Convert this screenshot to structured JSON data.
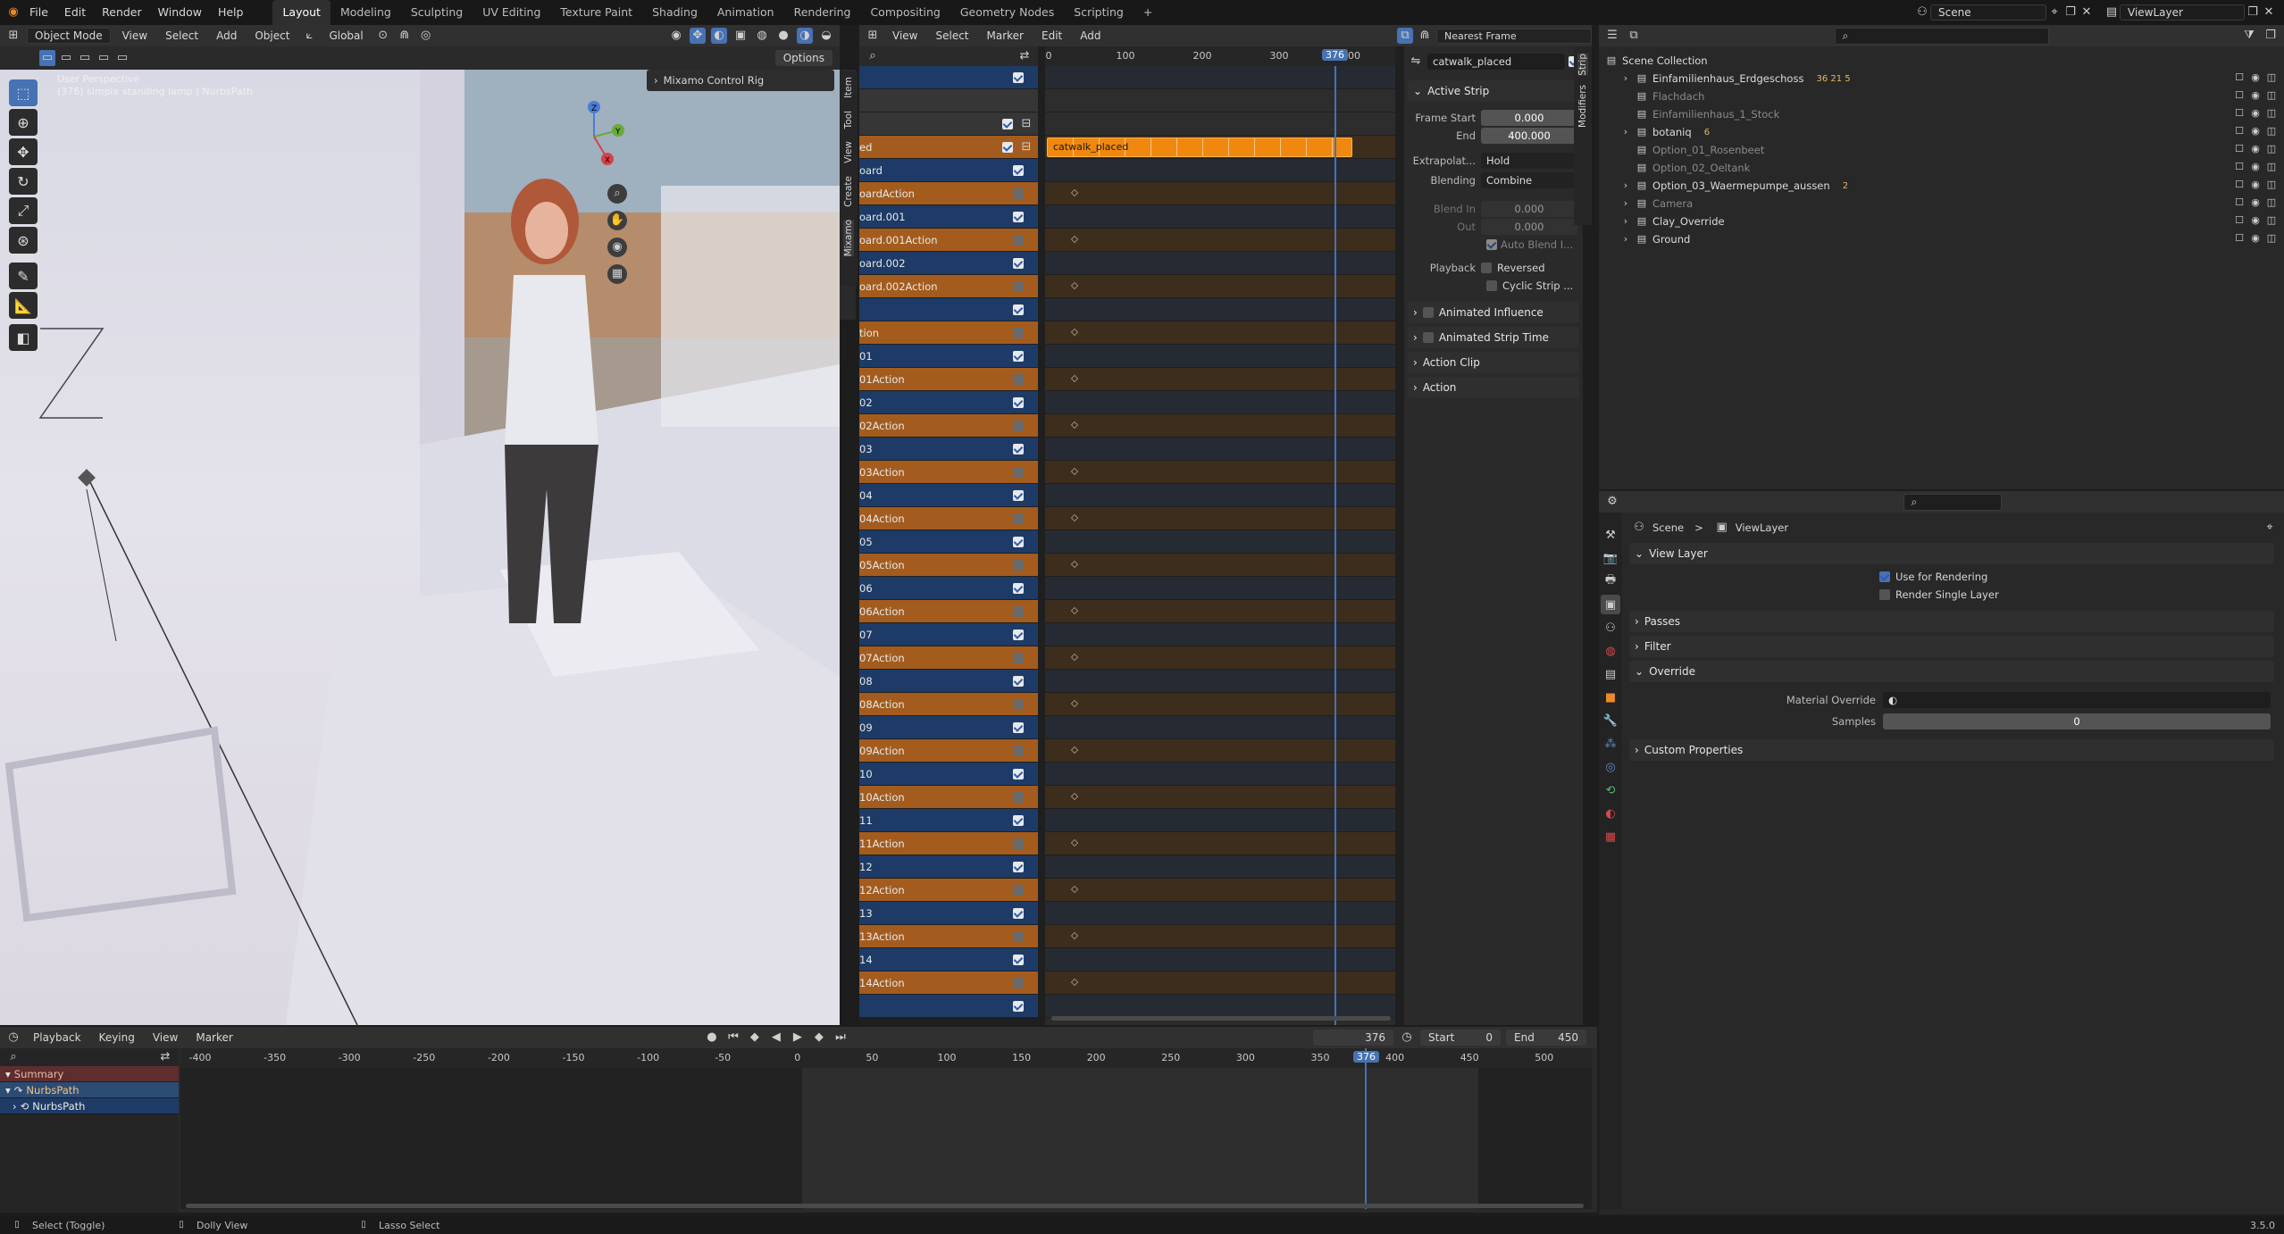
{
  "topbar": {
    "menus": [
      "File",
      "Edit",
      "Render",
      "Window",
      "Help"
    ],
    "workspaces": [
      "Layout",
      "Modeling",
      "Sculpting",
      "UV Editing",
      "Texture Paint",
      "Shading",
      "Animation",
      "Rendering",
      "Compositing",
      "Geometry Nodes",
      "Scripting"
    ],
    "active_workspace": "Layout",
    "add_tab": "+",
    "scene": "Scene",
    "view_layer": "ViewLayer"
  },
  "viewport": {
    "header": {
      "mode": "Object Mode",
      "view": "View",
      "select": "Select",
      "add": "Add",
      "object": "Object",
      "orientation": "Global"
    },
    "options": "Options",
    "overlay_title": "User Perspective",
    "overlay_sub": "(376) simple standing lamp | NurbsPath",
    "popup": "Mixamo Control Rig",
    "side_tabs": [
      "Item",
      "Tool",
      "View",
      "Create",
      "Mixamo"
    ],
    "gizmo": {
      "x": "X",
      "y": "Y",
      "z": "Z"
    }
  },
  "nla": {
    "menus": [
      "View",
      "Select",
      "Marker",
      "Edit",
      "Add"
    ],
    "snap": "Nearest Frame",
    "ruler": [
      "0",
      "100",
      "200",
      "300"
    ],
    "current_frame": "376",
    "ruler_after": "00",
    "strip_label": "catwalk_placed",
    "rows": [
      {
        "label": "",
        "type": "blue",
        "check": true,
        "icon": "cb"
      },
      {
        "label": "",
        "type": "dark",
        "check": false,
        "icon": ""
      },
      {
        "label": "",
        "type": "dark",
        "check": true,
        "icon": "lock"
      },
      {
        "label": "ed",
        "type": "orange",
        "check": true,
        "icon": "lock",
        "strip": true
      },
      {
        "label": "oard",
        "type": "blue",
        "check": true,
        "icon": "cb"
      },
      {
        "label": "oardAction",
        "type": "orange",
        "check": false,
        "icon": "sheet"
      },
      {
        "label": "oard.001",
        "type": "blue",
        "check": true,
        "icon": "cb"
      },
      {
        "label": "oard.001Action",
        "type": "orange",
        "check": false,
        "icon": "sheet"
      },
      {
        "label": "oard.002",
        "type": "blue",
        "check": true,
        "icon": "cb"
      },
      {
        "label": "oard.002Action",
        "type": "orange",
        "check": false,
        "icon": "sheet"
      },
      {
        "label": "",
        "type": "blue",
        "check": true,
        "icon": "cb"
      },
      {
        "label": "tion",
        "type": "orange",
        "check": false,
        "icon": "sheet"
      },
      {
        "label": "01",
        "type": "blue",
        "check": true,
        "icon": "cb"
      },
      {
        "label": "01Action",
        "type": "orange",
        "check": false,
        "icon": "sheet"
      },
      {
        "label": "02",
        "type": "blue",
        "check": true,
        "icon": "cb"
      },
      {
        "label": "02Action",
        "type": "orange",
        "check": false,
        "icon": "sheet"
      },
      {
        "label": "03",
        "type": "blue",
        "check": true,
        "icon": "cb"
      },
      {
        "label": "03Action",
        "type": "orange",
        "check": false,
        "icon": "sheet"
      },
      {
        "label": "04",
        "type": "blue",
        "check": true,
        "icon": "cb"
      },
      {
        "label": "04Action",
        "type": "orange",
        "check": false,
        "icon": "sheet"
      },
      {
        "label": "05",
        "type": "blue",
        "check": true,
        "icon": "cb"
      },
      {
        "label": "05Action",
        "type": "orange",
        "check": false,
        "icon": "sheet"
      },
      {
        "label": "06",
        "type": "blue",
        "check": true,
        "icon": "cb"
      },
      {
        "label": "06Action",
        "type": "orange",
        "check": false,
        "icon": "sheet"
      },
      {
        "label": "07",
        "type": "blue",
        "check": true,
        "icon": "cb"
      },
      {
        "label": "07Action",
        "type": "orange",
        "check": false,
        "icon": "sheet"
      },
      {
        "label": "08",
        "type": "blue",
        "check": true,
        "icon": "cb"
      },
      {
        "label": "08Action",
        "type": "orange",
        "check": false,
        "icon": "sheet"
      },
      {
        "label": "09",
        "type": "blue",
        "check": true,
        "icon": "cb"
      },
      {
        "label": "09Action",
        "type": "orange",
        "check": false,
        "icon": "sheet"
      },
      {
        "label": "10",
        "type": "blue",
        "check": true,
        "icon": "cb"
      },
      {
        "label": "10Action",
        "type": "orange",
        "check": false,
        "icon": "sheet"
      },
      {
        "label": "11",
        "type": "blue",
        "check": true,
        "icon": "cb"
      },
      {
        "label": "11Action",
        "type": "orange",
        "check": false,
        "icon": "sheet"
      },
      {
        "label": "12",
        "type": "blue",
        "check": true,
        "icon": "cb"
      },
      {
        "label": "12Action",
        "type": "orange",
        "check": false,
        "icon": "sheet"
      },
      {
        "label": "13",
        "type": "blue",
        "check": true,
        "icon": "cb"
      },
      {
        "label": "13Action",
        "type": "orange",
        "check": false,
        "icon": "sheet"
      },
      {
        "label": "14",
        "type": "blue",
        "check": true,
        "icon": "cb"
      },
      {
        "label": "14Action",
        "type": "orange",
        "check": false,
        "icon": "sheet"
      },
      {
        "label": "",
        "type": "blue",
        "check": true,
        "icon": "cb"
      }
    ],
    "sidebar": {
      "strip_name": "catwalk_placed",
      "tabs": [
        "Strip",
        "Modifiers"
      ],
      "active_strip": "Active Strip",
      "frame_start_label": "Frame Start",
      "frame_start": "0.000",
      "end_label": "End",
      "end": "400.000",
      "extrapolation_label": "Extrapolat...",
      "extrapolation": "Hold",
      "blending_label": "Blending",
      "blending": "Combine",
      "blend_in_label": "Blend In",
      "blend_in": "0.000",
      "out_label": "Out",
      "out": "0.000",
      "auto_blend": "Auto Blend I...",
      "playback_label": "Playback",
      "reversed": "Reversed",
      "cyclic": "Cyclic Strip ...",
      "animated_influence": "Animated Influence",
      "animated_strip_time": "Animated Strip Time",
      "action_clip": "Action Clip",
      "action": "Action"
    }
  },
  "outliner": {
    "root": "Scene Collection",
    "items": [
      {
        "name": "Einfamilienhaus_Erdgeschoss",
        "dim": false,
        "expand": true,
        "badges": "36 21 5"
      },
      {
        "name": "Flachdach",
        "dim": true,
        "expand": false,
        "badges": ""
      },
      {
        "name": "Einfamilienhaus_1_Stock",
        "dim": true,
        "expand": false,
        "badges": ""
      },
      {
        "name": "botaniq",
        "dim": false,
        "expand": true,
        "badges": "6"
      },
      {
        "name": "Option_01_Rosenbeet",
        "dim": true,
        "expand": false,
        "badges": ""
      },
      {
        "name": "Option_02_Oeltank",
        "dim": true,
        "expand": false,
        "badges": ""
      },
      {
        "name": "Option_03_Waermepumpe_aussen",
        "dim": false,
        "expand": true,
        "badges": "2"
      },
      {
        "name": "Camera",
        "dim": true,
        "expand": true,
        "badges": ""
      },
      {
        "name": "Clay_Override",
        "dim": false,
        "expand": true,
        "badges": ""
      },
      {
        "name": "Ground",
        "dim": false,
        "expand": true,
        "badges": ""
      }
    ]
  },
  "properties": {
    "breadcrumb_scene": "Scene",
    "breadcrumb_sep": ">",
    "breadcrumb_layer": "ViewLayer",
    "view_layer_panel": "View Layer",
    "use_for_rendering": "Use for Rendering",
    "render_single_layer": "Render Single Layer",
    "passes": "Passes",
    "filter": "Filter",
    "override": "Override",
    "material_override_label": "Material Override",
    "samples_label": "Samples",
    "samples": "0",
    "custom_properties": "Custom Properties"
  },
  "dopesheet": {
    "menus": [
      "Playback",
      "Keying",
      "View",
      "Marker"
    ],
    "current_frame": "376",
    "start_label": "Start",
    "start": "0",
    "end_label": "End",
    "end": "450",
    "ruler": [
      "-400",
      "-350",
      "-300",
      "-250",
      "-200",
      "-150",
      "-100",
      "-50",
      "0",
      "50",
      "100",
      "150",
      "200",
      "250",
      "300",
      "350",
      "400",
      "450",
      "500"
    ],
    "channels": [
      "Summary",
      "NurbsPath",
      "NurbsPath"
    ]
  },
  "statusbar": {
    "select": "Select (Toggle)",
    "dolly": "Dolly View",
    "lasso": "Lasso Select",
    "version": "3.5.0"
  },
  "colors": {
    "accent": "#4772b3",
    "strip": "#f0880f",
    "blue_row": "#1d3b66",
    "orange_row": "#a35c1e"
  }
}
